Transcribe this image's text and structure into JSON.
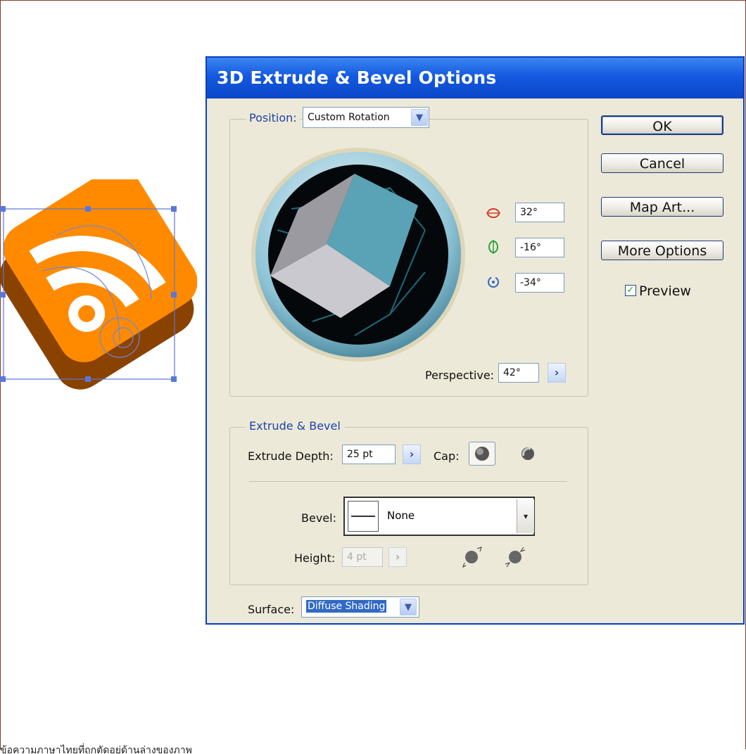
{
  "dialog": {
    "title": "3D Extrude & Bevel Options",
    "position": {
      "label": "Position:",
      "value": "Custom Rotation"
    },
    "rotation": {
      "x": "32°",
      "y": "-16°",
      "z": "-34°"
    },
    "perspective": {
      "label": "Perspective:",
      "value": "42°"
    },
    "extrude": {
      "legend": "Extrude & Bevel",
      "depth_label": "Extrude Depth:",
      "depth_value": "25 pt",
      "cap_label": "Cap:",
      "bevel_label": "Bevel:",
      "bevel_value": "None",
      "height_label": "Height:",
      "height_value": "4 pt"
    },
    "surface": {
      "label": "Surface:",
      "value": "Diffuse Shading"
    },
    "buttons": {
      "ok": "OK",
      "cancel": "Cancel",
      "map_art": "Map Art...",
      "more_options": "More Options"
    },
    "preview": {
      "label": "Preview",
      "checked": true
    }
  },
  "colors": {
    "title_bar": "#1459e0",
    "cube_face": "#5aa2b6",
    "artwork_orange": "#ff8a00",
    "artwork_brown": "#8a4200"
  },
  "footer_text": "ข้อความภาษาไทยที่ถูกตัดอยู่ด้านล่างของภาพ"
}
